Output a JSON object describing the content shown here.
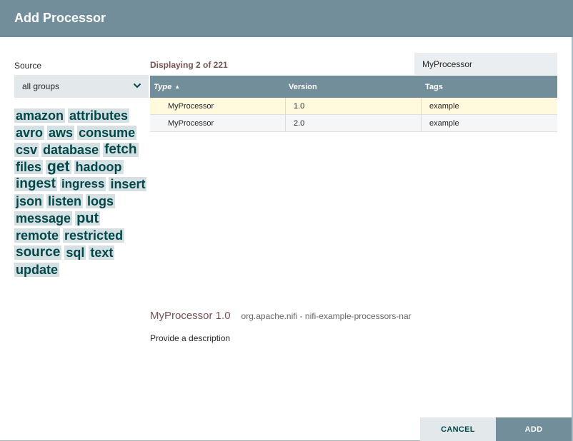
{
  "dialog": {
    "title": "Add Processor"
  },
  "source": {
    "label": "Source",
    "selected": "all groups"
  },
  "tags": [
    {
      "label": "amazon",
      "size": 18
    },
    {
      "label": "attributes",
      "size": 18
    },
    {
      "label": "avro",
      "size": 18
    },
    {
      "label": "aws",
      "size": 18
    },
    {
      "label": "consume",
      "size": 18
    },
    {
      "label": "csv",
      "size": 18
    },
    {
      "label": "database",
      "size": 18
    },
    {
      "label": "fetch",
      "size": 19
    },
    {
      "label": "files",
      "size": 18
    },
    {
      "label": "get",
      "size": 21
    },
    {
      "label": "hadoop",
      "size": 18
    },
    {
      "label": "ingest",
      "size": 19
    },
    {
      "label": "ingress",
      "size": 17
    },
    {
      "label": "insert",
      "size": 18
    },
    {
      "label": "json",
      "size": 18
    },
    {
      "label": "listen",
      "size": 18
    },
    {
      "label": "logs",
      "size": 18
    },
    {
      "label": "message",
      "size": 18
    },
    {
      "label": "put",
      "size": 20
    },
    {
      "label": "remote",
      "size": 18
    },
    {
      "label": "restricted",
      "size": 18
    },
    {
      "label": "source",
      "size": 19
    },
    {
      "label": "sql",
      "size": 18
    },
    {
      "label": "text",
      "size": 18
    },
    {
      "label": "update",
      "size": 18
    }
  ],
  "results": {
    "displaying": "Displaying 2 of 221",
    "filter_value": "MyProcessor"
  },
  "table": {
    "columns": {
      "type": "Type",
      "version": "Version",
      "tags": "Tags"
    },
    "rows": [
      {
        "type": "MyProcessor",
        "version": "1.0",
        "tags": "example",
        "selected": true
      },
      {
        "type": "MyProcessor",
        "version": "2.0",
        "tags": "example",
        "selected": false
      }
    ]
  },
  "description": {
    "name": "MyProcessor 1.0",
    "bundle": "org.apache.nifi - nifi-example-processors-nar",
    "text": "Provide a description"
  },
  "buttons": {
    "cancel": "CANCEL",
    "add": "ADD"
  },
  "colors": {
    "header": "#728e9b",
    "tag_bg": "#d6e0e3",
    "tag_text": "#004849",
    "accent_text": "#775351",
    "selected_row": "#fffadd"
  }
}
